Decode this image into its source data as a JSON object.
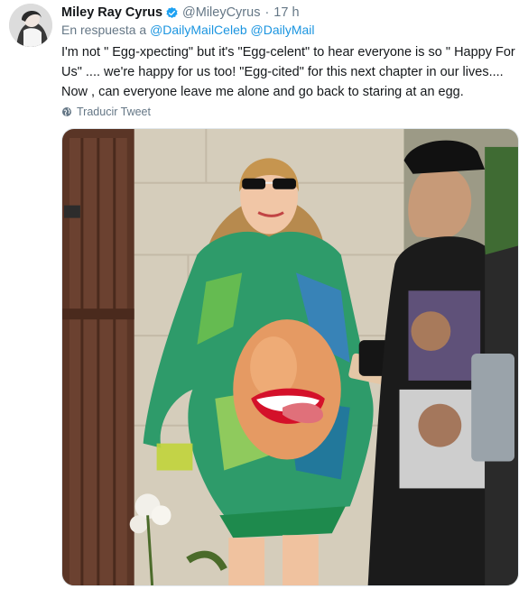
{
  "tweet": {
    "author_name": "Miley Ray Cyrus",
    "author_handle": "@MileyCyrus",
    "separator": "·",
    "time": "17 h",
    "reply_prefix": "En respuesta a",
    "reply_mentions": [
      "@DailyMailCeleb",
      "@DailyMail"
    ],
    "text": "I'm not \" Egg-xpecting\" but it's \"Egg-celent\" to hear everyone is so \" Happy For Us\" .... we're happy for us too! \"Egg-cited\" for this next chapter in our lives.... Now , can everyone leave me alone and go back to staring at an egg.",
    "translate_label": "Traducir Tweet",
    "icons": {
      "verified": "verified-badge-icon",
      "translate": "globe-icon"
    }
  },
  "colors": {
    "link": "#1b95e0",
    "secondary_text": "#657786",
    "verified_badge": "#1da1f2"
  }
}
